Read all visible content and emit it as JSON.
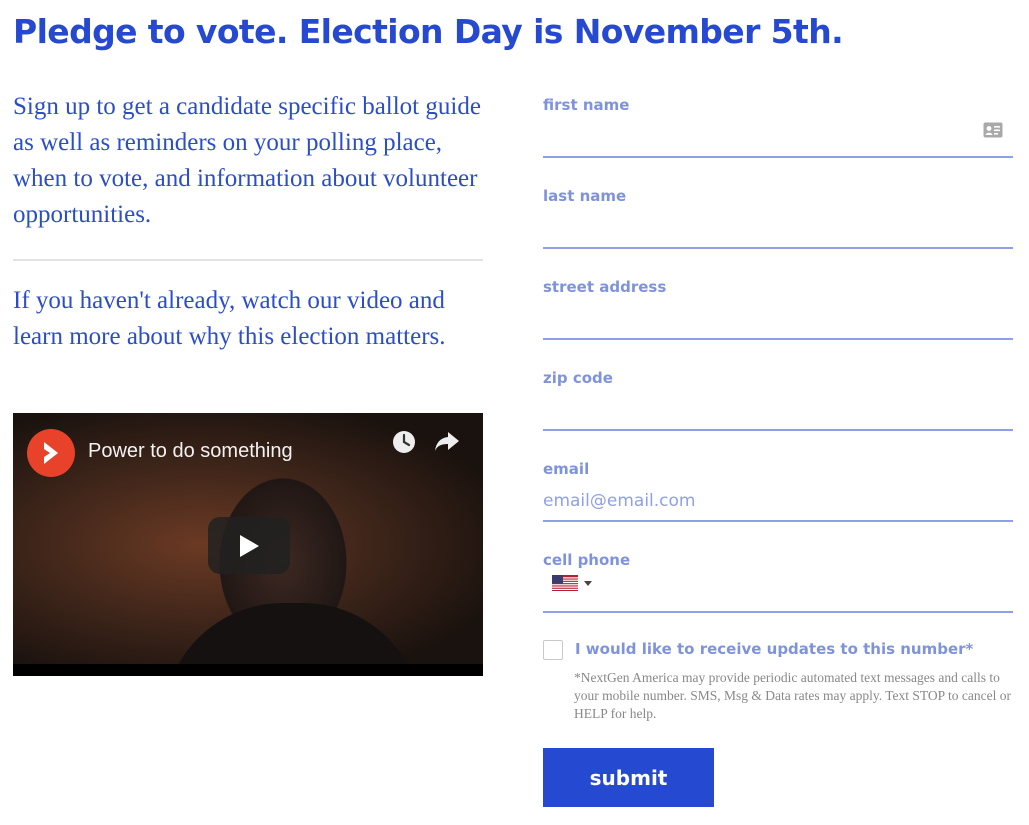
{
  "headline": "Pledge to vote. Election Day is November 5th.",
  "intro": "Sign up to get a candidate specific ballot guide as well as reminders on your polling place, when to vote, and information about volunteer opportunities.",
  "video_intro": "If you haven't already, watch our video and learn more about why this election matters.",
  "video": {
    "title": "Power to do something",
    "icons": [
      "channel-logo",
      "watch-later-icon",
      "share-icon",
      "play-icon"
    ]
  },
  "form": {
    "first_name": {
      "label": "first name",
      "value": "",
      "placeholder": ""
    },
    "last_name": {
      "label": "last name",
      "value": "",
      "placeholder": ""
    },
    "street_address": {
      "label": "street address",
      "value": "",
      "placeholder": ""
    },
    "zip_code": {
      "label": "zip code",
      "value": "",
      "placeholder": ""
    },
    "email": {
      "label": "email",
      "value": "",
      "placeholder": "email@email.com"
    },
    "cell_phone": {
      "label": "cell phone",
      "value": "",
      "country": "US flag"
    },
    "sms_optin": {
      "label": "I would like to receive updates to this number*",
      "checked": false
    },
    "disclaimer": "*NextGen America may provide periodic automated text messages and calls to your mobile number. SMS, Msg & Data rates may apply. Text STOP to cancel or HELP for help.",
    "submit_label": "submit"
  },
  "colors": {
    "brand_blue": "#2649d1",
    "label_blue": "#7f93dd",
    "underline": "#8fa0e8"
  }
}
